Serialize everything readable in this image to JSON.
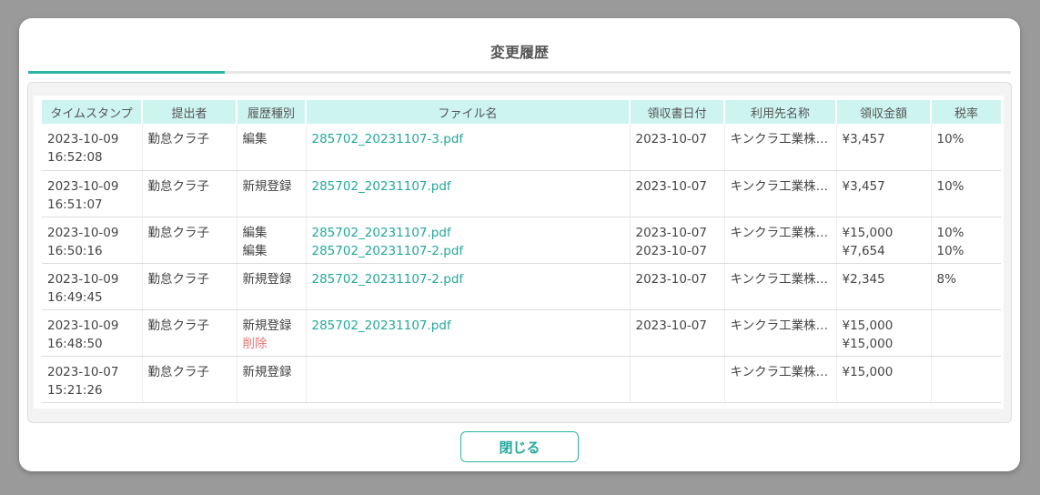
{
  "modal": {
    "title": "変更履歴",
    "close_label": "閉じる"
  },
  "colors": {
    "accent": "#2bb3a3",
    "header_bg": "#cdf4ef",
    "delete": "#e87474"
  },
  "table": {
    "headers": [
      "タイムスタンプ",
      "提出者",
      "履歴種別",
      "ファイル名",
      "領収書日付",
      "利用先名称",
      "領収金額",
      "税率"
    ],
    "rows": [
      {
        "timestamp": [
          "2023-10-09",
          "16:52:08"
        ],
        "submitter": "勤怠クラ子",
        "types": [
          {
            "text": "編集",
            "deleted": false
          }
        ],
        "files": [
          "285702_20231107-3.pdf"
        ],
        "receipt_dates": [
          "2023-10-07"
        ],
        "vendor": "キンクラ工業株…",
        "amounts": [
          "¥3,457"
        ],
        "tax_rates": [
          "10%"
        ]
      },
      {
        "timestamp": [
          "2023-10-09",
          "16:51:07"
        ],
        "submitter": "勤怠クラ子",
        "types": [
          {
            "text": "新規登録",
            "deleted": false
          }
        ],
        "files": [
          "285702_20231107.pdf"
        ],
        "receipt_dates": [
          "2023-10-07"
        ],
        "vendor": "キンクラ工業株…",
        "amounts": [
          "¥3,457"
        ],
        "tax_rates": [
          "10%"
        ]
      },
      {
        "timestamp": [
          "2023-10-09",
          "16:50:16"
        ],
        "submitter": "勤怠クラ子",
        "types": [
          {
            "text": "編集",
            "deleted": false
          },
          {
            "text": "編集",
            "deleted": false
          }
        ],
        "files": [
          "285702_20231107.pdf",
          "285702_20231107-2.pdf"
        ],
        "receipt_dates": [
          "2023-10-07",
          "2023-10-07"
        ],
        "vendor": "キンクラ工業株…",
        "amounts": [
          "¥15,000",
          "¥7,654"
        ],
        "tax_rates": [
          "10%",
          "10%"
        ]
      },
      {
        "timestamp": [
          "2023-10-09",
          "16:49:45"
        ],
        "submitter": "勤怠クラ子",
        "types": [
          {
            "text": "新規登録",
            "deleted": false
          }
        ],
        "files": [
          "285702_20231107-2.pdf"
        ],
        "receipt_dates": [
          "2023-10-07"
        ],
        "vendor": "キンクラ工業株…",
        "amounts": [
          "¥2,345"
        ],
        "tax_rates": [
          "8%"
        ]
      },
      {
        "timestamp": [
          "2023-10-09",
          "16:48:50"
        ],
        "submitter": "勤怠クラ子",
        "types": [
          {
            "text": "新規登録",
            "deleted": false
          },
          {
            "text": "削除",
            "deleted": true
          }
        ],
        "files": [
          "285702_20231107.pdf"
        ],
        "receipt_dates": [
          "2023-10-07"
        ],
        "vendor": "キンクラ工業株…",
        "amounts": [
          "¥15,000",
          "¥15,000"
        ],
        "tax_rates": []
      },
      {
        "timestamp": [
          "2023-10-07",
          "15:21:26"
        ],
        "submitter": "勤怠クラ子",
        "types": [
          {
            "text": "新規登録",
            "deleted": false
          }
        ],
        "files": [],
        "receipt_dates": [],
        "vendor": "キンクラ工業株…",
        "amounts": [
          "¥15,000"
        ],
        "tax_rates": []
      }
    ]
  }
}
